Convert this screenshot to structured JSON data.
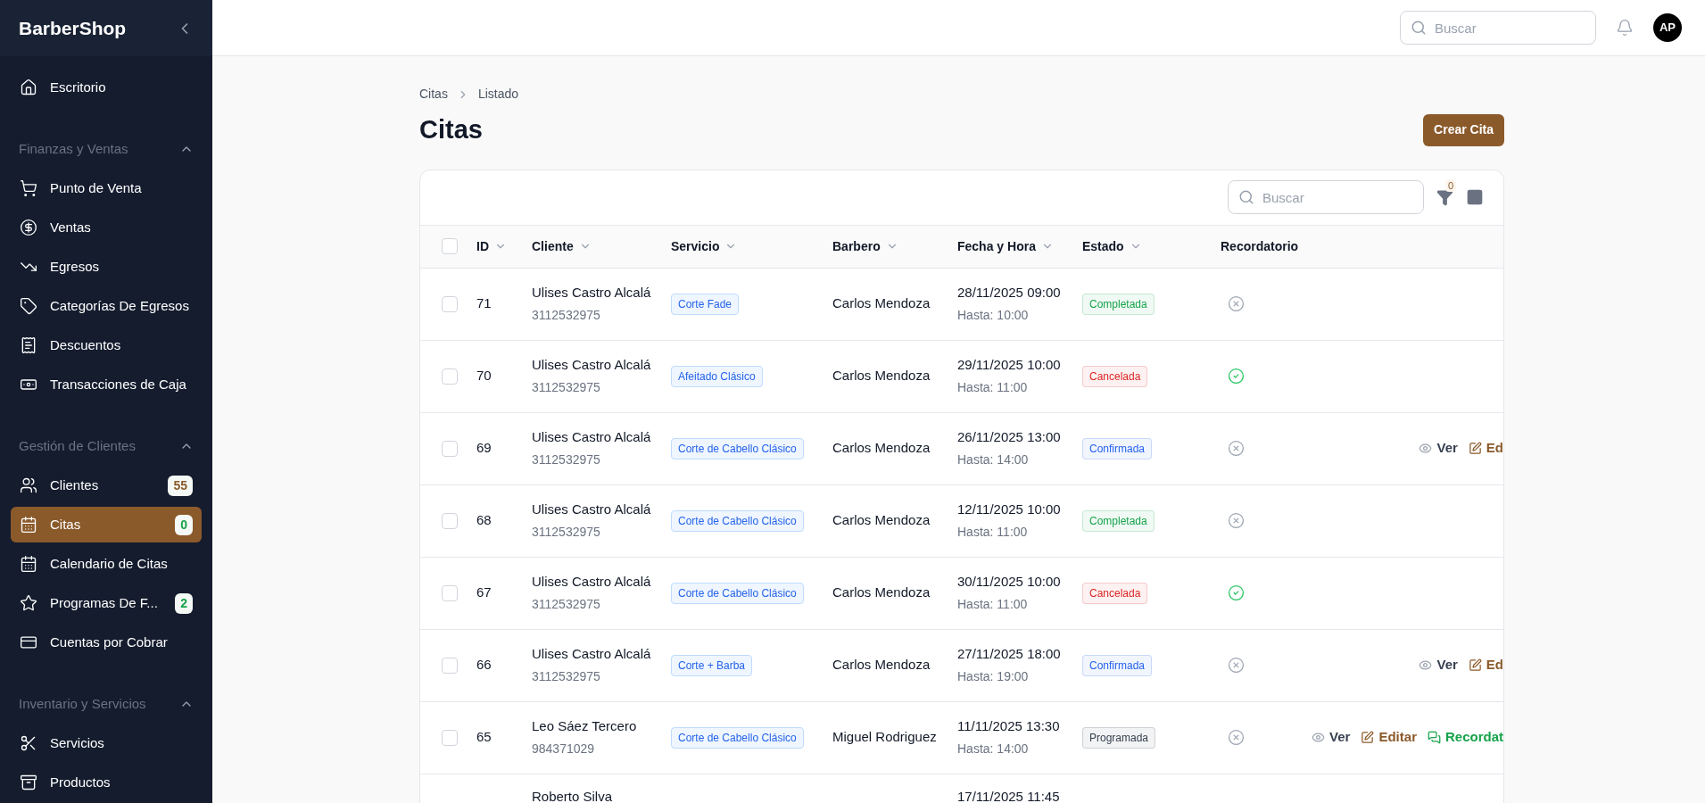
{
  "brand": "BarberShop",
  "sidebar": {
    "items": [
      {
        "kind": "link",
        "label": "Escritorio",
        "selected": false
      },
      {
        "kind": "group",
        "label": "Finanzas y Ventas",
        "expanded": true,
        "children": [
          {
            "label": "Punto de Venta",
            "selected": false
          },
          {
            "label": "Ventas",
            "selected": false
          },
          {
            "label": "Egresos",
            "selected": false
          },
          {
            "label": "Categorías De Egresos",
            "selected": false
          },
          {
            "label": "Descuentos",
            "selected": false
          },
          {
            "label": "Transacciones de Caja",
            "selected": false
          }
        ]
      },
      {
        "kind": "group",
        "label": "Gestión de Clientes",
        "expanded": true,
        "children": [
          {
            "label": "Clientes",
            "selected": false,
            "badge": "55",
            "color": "#8b5a2b"
          },
          {
            "label": "Citas",
            "selected": true,
            "badge": "0",
            "color": "#16a34a"
          },
          {
            "label": "Calendario de Citas",
            "selected": false
          },
          {
            "label": "Programas De F...",
            "selected": false,
            "badge": "2",
            "color": "#16a34a"
          },
          {
            "label": "Cuentas por Cobrar",
            "selected": false
          }
        ]
      },
      {
        "kind": "group",
        "label": "Inventario y Servicios",
        "expanded": true,
        "children": [
          {
            "label": "Servicios",
            "selected": false
          },
          {
            "label": "Productos",
            "selected": false
          }
        ]
      }
    ]
  },
  "topbar": {
    "search": {
      "placeholder": "Buscar"
    },
    "avatar": "AP"
  },
  "breadcrumb": [
    "Citas",
    "Listado"
  ],
  "title": "Citas",
  "create_button": "Crear Cita",
  "table": {
    "search": {
      "placeholder": "Buscar"
    },
    "filter_count": "0",
    "all_checked": false,
    "columns": [
      {
        "label": "ID",
        "sortable": true
      },
      {
        "label": "Cliente",
        "sortable": true
      },
      {
        "label": "Servicio",
        "sortable": true
      },
      {
        "label": "Barbero",
        "sortable": true
      },
      {
        "label": "Fecha y Hora",
        "sortable": true
      },
      {
        "label": "Estado",
        "sortable": true
      },
      {
        "label": "Recordatorio",
        "sortable": false
      }
    ],
    "rows": [
      {
        "checked": false,
        "id": "71",
        "client": "Ulises Castro Alcalá",
        "phone": "3112532975",
        "service": "Corte Fade",
        "barber": "Carlos Mendoza",
        "date": "28/11/2025 09:00",
        "until": "Hasta: 10:00",
        "status": "Completada",
        "color": "#16a34a",
        "reminder_sent": false,
        "actions": []
      },
      {
        "checked": false,
        "id": "70",
        "client": "Ulises Castro Alcalá",
        "phone": "3112532975",
        "service": "Afeitado Clásico",
        "barber": "Carlos Mendoza",
        "date": "29/11/2025 10:00",
        "until": "Hasta: 11:00",
        "status": "Cancelada",
        "color": "#dc2626",
        "reminder_sent": true,
        "actions": []
      },
      {
        "checked": false,
        "id": "69",
        "client": "Ulises Castro Alcalá",
        "phone": "3112532975",
        "service": "Corte de Cabello Clásico",
        "barber": "Carlos Mendoza",
        "date": "26/11/2025 13:00",
        "until": "Hasta: 14:00",
        "status": "Confirmada",
        "color": "#2563eb",
        "reminder_sent": false,
        "actions": [
          {
            "kind": "view",
            "label": "Ver"
          },
          {
            "kind": "edit",
            "label": "Ed"
          }
        ]
      },
      {
        "checked": false,
        "id": "68",
        "client": "Ulises Castro Alcalá",
        "phone": "3112532975",
        "service": "Corte de Cabello Clásico",
        "barber": "Carlos Mendoza",
        "date": "12/11/2025 10:00",
        "until": "Hasta: 11:00",
        "status": "Completada",
        "color": "#16a34a",
        "reminder_sent": false,
        "actions": []
      },
      {
        "checked": false,
        "id": "67",
        "client": "Ulises Castro Alcalá",
        "phone": "3112532975",
        "service": "Corte de Cabello Clásico",
        "barber": "Carlos Mendoza",
        "date": "30/11/2025 10:00",
        "until": "Hasta: 11:00",
        "status": "Cancelada",
        "color": "#dc2626",
        "reminder_sent": true,
        "actions": []
      },
      {
        "checked": false,
        "id": "66",
        "client": "Ulises Castro Alcalá",
        "phone": "3112532975",
        "service": "Corte + Barba",
        "barber": "Carlos Mendoza",
        "date": "27/11/2025 18:00",
        "until": "Hasta: 19:00",
        "status": "Confirmada",
        "color": "#2563eb",
        "reminder_sent": false,
        "actions": [
          {
            "kind": "view",
            "label": "Ver"
          },
          {
            "kind": "edit",
            "label": "Ed"
          }
        ]
      },
      {
        "checked": false,
        "id": "65",
        "client": "Leo Sáez Tercero",
        "phone": "984371029",
        "service": "Corte de Cabello Clásico",
        "barber": "Miguel Rodriguez",
        "date": "11/11/2025 13:30",
        "until": "Hasta: 14:00",
        "status": "Programada",
        "color": "#374151",
        "reminder_sent": false,
        "actions": [
          {
            "kind": "view",
            "label": "Ver"
          },
          {
            "kind": "edit",
            "label": "Editar"
          },
          {
            "kind": "remind",
            "label": "Recordat"
          }
        ]
      },
      {
        "kind": "partial",
        "client": "Roberto Silva",
        "date": "17/11/2025 11:45"
      }
    ]
  }
}
